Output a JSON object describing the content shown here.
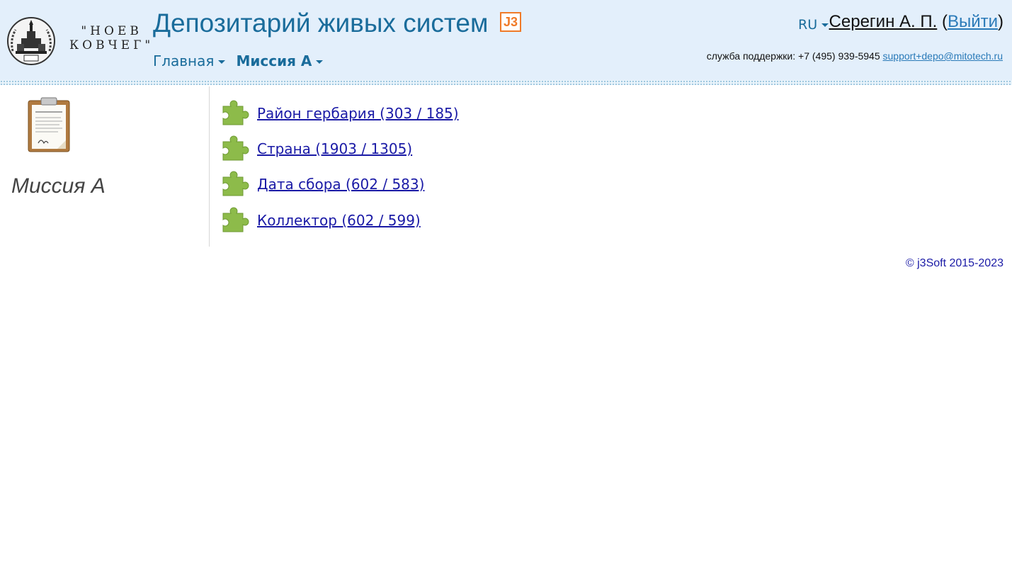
{
  "header": {
    "logo_line1": "\"НОЕВ",
    "logo_line2": "КОВЧЕГ\"",
    "title": "Депозитарий живых систем",
    "badge": "J3",
    "nav": [
      {
        "label": "Главная"
      },
      {
        "label": "Миссия А"
      }
    ],
    "lang": "RU",
    "user_name": "Серегин А. П.",
    "logout_label": "Выйти",
    "support_label": "служба поддержки: +7 (495) 939-5945",
    "support_email": "support+depo@mitotech.ru"
  },
  "left_panel": {
    "title": "Миссия А"
  },
  "items": [
    {
      "label": "Район гербария (303 / 185)"
    },
    {
      "label": "Страна (1903 / 1305)"
    },
    {
      "label": "Дата сбора (602 / 583)"
    },
    {
      "label": "Коллектор (602 / 599)"
    }
  ],
  "footer": {
    "copyright": "© j3Soft 2015-2023"
  },
  "colors": {
    "header_bg": "#e3effb",
    "accent_blue": "#1a6c9b",
    "link_blue": "#1a1aa6",
    "badge_orange": "#f07a28",
    "puzzle_green": "#8dbb4a"
  }
}
